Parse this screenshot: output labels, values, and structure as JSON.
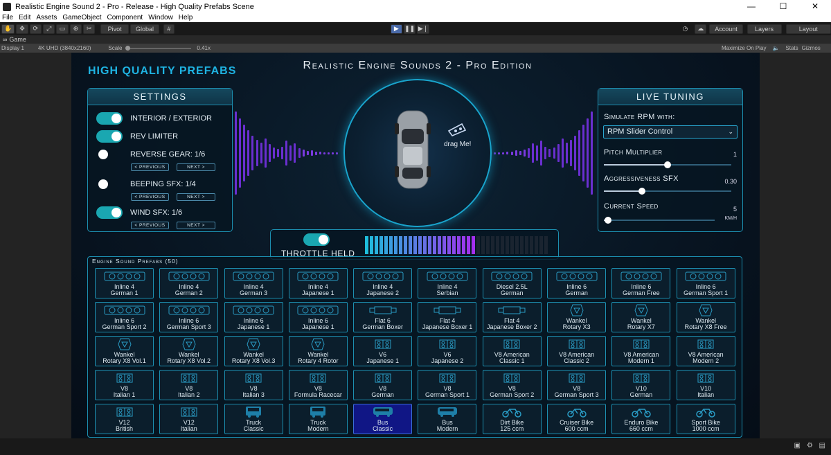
{
  "window": {
    "title": "Realistic Engine Sound 2 - Pro - Release - High Quality Prefabs Scene",
    "controls": [
      "—",
      "☐",
      "✕"
    ]
  },
  "menu": [
    "File",
    "Edit",
    "Assets",
    "GameObject",
    "Component",
    "Window",
    "Help"
  ],
  "toolbar": {
    "pivot": "Pivot",
    "global": "Global",
    "account": "Account",
    "layers": "Layers",
    "layout": "Layout"
  },
  "tab": {
    "game": "Game"
  },
  "gamebar": {
    "display": "Display 1",
    "resolution": "4K UHD (3840x2160)",
    "scale_label": "Scale",
    "scale_value": "0.41x",
    "maximize": "Maximize On Play",
    "stats": "Stats",
    "gizmos": "Gizmos"
  },
  "scene": {
    "hq_title": "High Quality Prefabs",
    "main_title": "Realistic Engine Sounds 2 - Pro Edition"
  },
  "settings": {
    "title": "Settings",
    "interior": "INTERIOR / EXTERIOR",
    "rev": "REV LIMITER",
    "reverse": "REVERSE GEAR: 1/6",
    "beeping": "BEEPING SFX: 1/4",
    "wind": "WIND SFX: 1/6",
    "previous": "< PREVIOUS",
    "next": "NEXT >"
  },
  "center": {
    "drag": "drag Me!",
    "throttle": "THROTTLE HELD",
    "throttle_level": 0.61
  },
  "live": {
    "title": "Live Tuning",
    "simulate": "Simulate RPM with:",
    "dropdown": "RPM Slider Control",
    "pitch_label": "Pitch Multiplier",
    "pitch_value": "1",
    "pitch_pos": 0.5,
    "aggr_label": "Aggressiveness SFX",
    "aggr_value": "0.30",
    "aggr_pos": 0.3,
    "speed_label": "Current Speed",
    "speed_value": "5",
    "speed_unit": "KM/H",
    "speed_pos": 0.04
  },
  "prefabs": {
    "title": "Engine Sound Prefabs (50)",
    "items": [
      {
        "l1": "Inline 4",
        "l2": "German 1",
        "icon": "engine"
      },
      {
        "l1": "Inline 4",
        "l2": "German 2",
        "icon": "engine"
      },
      {
        "l1": "Inline 4",
        "l2": "German 3",
        "icon": "engine"
      },
      {
        "l1": "Inline 4",
        "l2": "Japanese 1",
        "icon": "engine"
      },
      {
        "l1": "Inline 4",
        "l2": "Japanese 2",
        "icon": "engine"
      },
      {
        "l1": "Inline 4",
        "l2": "Serbian",
        "icon": "engine"
      },
      {
        "l1": "Diesel 2.5L",
        "l2": "German",
        "icon": "engine"
      },
      {
        "l1": "Inline 6",
        "l2": "German",
        "icon": "engine"
      },
      {
        "l1": "Inline 6",
        "l2": "German Free",
        "icon": "engine"
      },
      {
        "l1": "Inline 6",
        "l2": "German Sport 1",
        "icon": "engine"
      },
      {
        "l1": "Inline 6",
        "l2": "German Sport 2",
        "icon": "engine"
      },
      {
        "l1": "Inline 6",
        "l2": "German Sport 3",
        "icon": "engine"
      },
      {
        "l1": "Inline 6",
        "l2": "Japanese 1",
        "icon": "engine"
      },
      {
        "l1": "Inline 6",
        "l2": "Japanese 1",
        "icon": "engine"
      },
      {
        "l1": "Flat 6",
        "l2": "German Boxer",
        "icon": "flat"
      },
      {
        "l1": "Flat 4",
        "l2": "Japanese Boxer 1",
        "icon": "flat"
      },
      {
        "l1": "Flat 4",
        "l2": "Japanese Boxer 2",
        "icon": "flat"
      },
      {
        "l1": "Wankel",
        "l2": "Rotary X3",
        "icon": "rotary"
      },
      {
        "l1": "Wankel",
        "l2": "Rotary X7",
        "icon": "rotary"
      },
      {
        "l1": "Wankel",
        "l2": "Rotary X8 Free",
        "icon": "rotary"
      },
      {
        "l1": "Wankel",
        "l2": "Rotary X8 Vol.1",
        "icon": "rotary"
      },
      {
        "l1": "Wankel",
        "l2": "Rotary X8 Vol.2",
        "icon": "rotary"
      },
      {
        "l1": "Wankel",
        "l2": "Rotary X8 Vol.3",
        "icon": "rotary"
      },
      {
        "l1": "Wankel",
        "l2": "Rotary 4 Rotor",
        "icon": "rotary"
      },
      {
        "l1": "V6",
        "l2": "Japanese 1",
        "icon": "v"
      },
      {
        "l1": "V6",
        "l2": "Japanese 2",
        "icon": "v"
      },
      {
        "l1": "V8 American",
        "l2": "Classic 1",
        "icon": "v"
      },
      {
        "l1": "V8 American",
        "l2": "Classic 2",
        "icon": "v"
      },
      {
        "l1": "V8 American",
        "l2": "Modern 1",
        "icon": "v"
      },
      {
        "l1": "V8 American",
        "l2": "Modern 2",
        "icon": "v"
      },
      {
        "l1": "V8",
        "l2": "Italian 1",
        "icon": "v"
      },
      {
        "l1": "V8",
        "l2": "Italian 2",
        "icon": "v"
      },
      {
        "l1": "V8",
        "l2": "Italian 3",
        "icon": "v"
      },
      {
        "l1": "V8",
        "l2": "Formula Racecar",
        "icon": "v"
      },
      {
        "l1": "V8",
        "l2": "German",
        "icon": "v"
      },
      {
        "l1": "V8",
        "l2": "German Sport 1",
        "icon": "v"
      },
      {
        "l1": "V8",
        "l2": "German Sport 2",
        "icon": "v"
      },
      {
        "l1": "V8",
        "l2": "German Sport 3",
        "icon": "v"
      },
      {
        "l1": "V10",
        "l2": "German",
        "icon": "v"
      },
      {
        "l1": "V10",
        "l2": "Italian",
        "icon": "v"
      },
      {
        "l1": "V12",
        "l2": "British",
        "icon": "v"
      },
      {
        "l1": "V12",
        "l2": "Italian",
        "icon": "v"
      },
      {
        "l1": "Truck",
        "l2": "Classic",
        "icon": "truck"
      },
      {
        "l1": "Truck",
        "l2": "Modern",
        "icon": "truck"
      },
      {
        "l1": "Bus",
        "l2": "Classic",
        "icon": "bus",
        "selected": true
      },
      {
        "l1": "Bus",
        "l2": "Modern",
        "icon": "bus"
      },
      {
        "l1": "Dirt Bike",
        "l2": "125 ccm",
        "icon": "bike"
      },
      {
        "l1": "Cruiser Bike",
        "l2": "600 ccm",
        "icon": "bike"
      },
      {
        "l1": "Enduro Bike",
        "l2": "660 ccm",
        "icon": "bike"
      },
      {
        "l1": "Sport Bike",
        "l2": "1000 ccm",
        "icon": "bike"
      }
    ]
  }
}
